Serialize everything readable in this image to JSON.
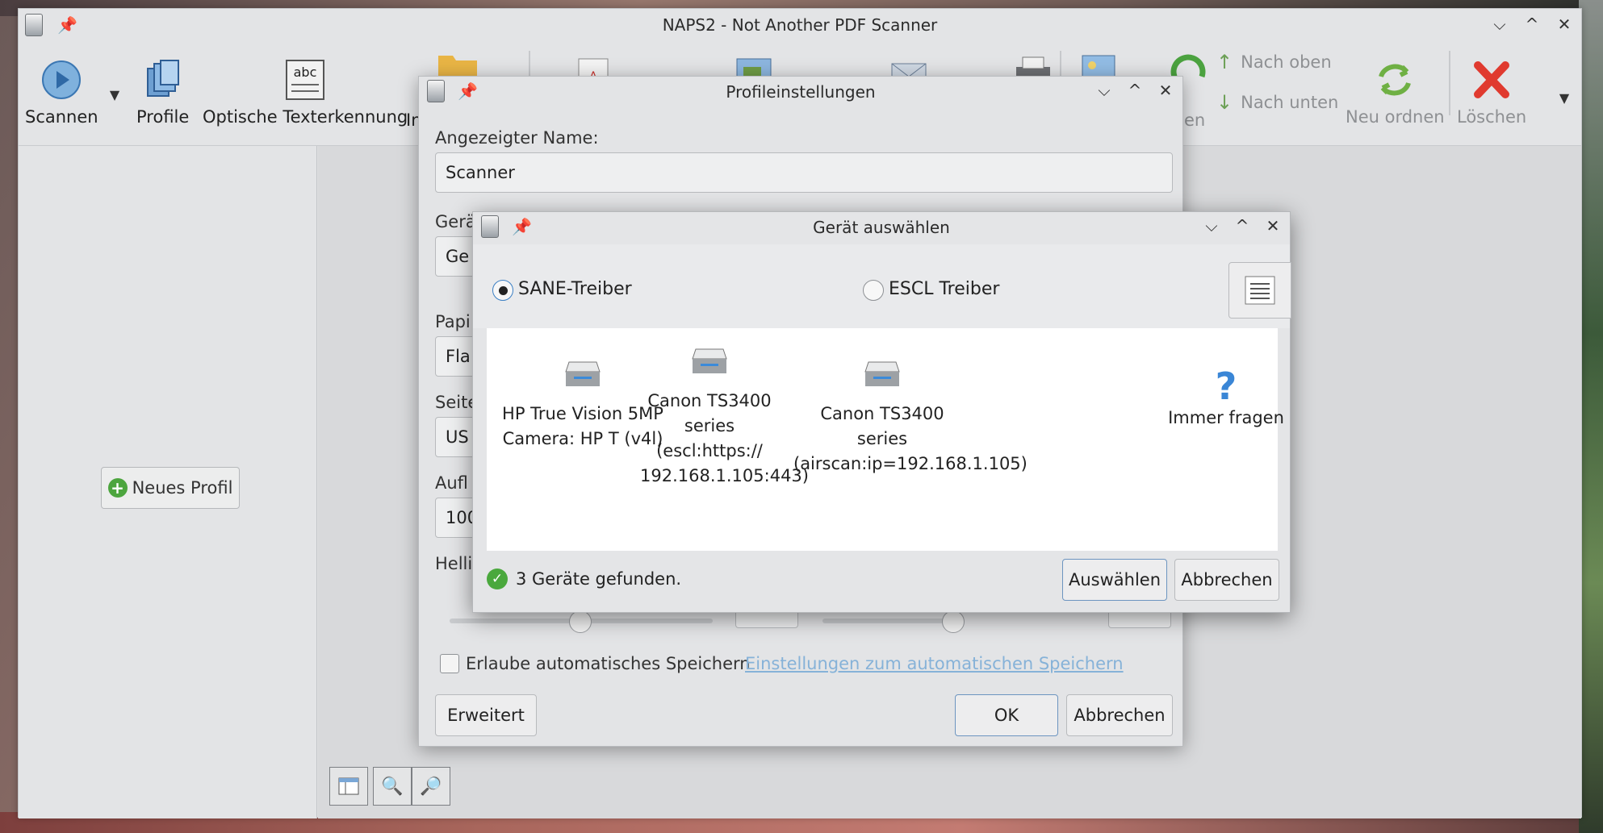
{
  "app": {
    "title": "NAPS2 - Not Another PDF Scanner"
  },
  "toolbar": {
    "scan": "Scannen",
    "profiles": "Profile",
    "ocr": "Optische Texterkennung",
    "import_partial": "In",
    "move_partial": "en",
    "move_up": "Nach oben",
    "move_down": "Nach unten",
    "reorder": "Neu ordnen",
    "delete": "Löschen",
    "ocr_icon_text": "abc"
  },
  "left": {
    "new_profile": "Neues Profil"
  },
  "profile_dialog": {
    "title": "Profileinstellungen",
    "name_label": "Angezeigter Name:",
    "name_value": "Scanner",
    "device_label_partial": "Gerä",
    "device_value_partial": "Ge",
    "paper_label_partial": "Papi",
    "paper_value_partial": "Fla",
    "page_label_partial": "Seite",
    "page_value_partial": "US",
    "res_label_partial": "Aufl",
    "res_value_partial": "100",
    "bright_label_partial": "Helli",
    "autosave": "Erlaube automatisches Speichern",
    "autosave_link": "Einstellungen zum automatischen Speichern",
    "advanced": "Erweitert",
    "ok": "OK",
    "cancel": "Abbrechen"
  },
  "device_dialog": {
    "title": "Gerät auswählen",
    "driver_sane": "SANE-Treiber",
    "driver_escl": "ESCL Treiber",
    "devices": [
      {
        "line1": "HP True Vision 5MP",
        "line2": "Camera: HP T (v4l)",
        "line3": ""
      },
      {
        "line1": "Canon TS3400",
        "line2": "series (escl:https://",
        "line3": "192.168.1.105:443)"
      },
      {
        "line1": "Canon TS3400 series",
        "line2": "(airscan:ip=192.168.1.105)",
        "line3": ""
      },
      {
        "line1": "Immer fragen",
        "line2": "",
        "line3": ""
      }
    ],
    "status": "3 Geräte gefunden.",
    "select": "Auswählen",
    "cancel": "Abbrechen"
  },
  "colors": {
    "accent": "#3b7fc4",
    "ok_green": "#4aa83d",
    "delete_red": "#e03a2f"
  }
}
